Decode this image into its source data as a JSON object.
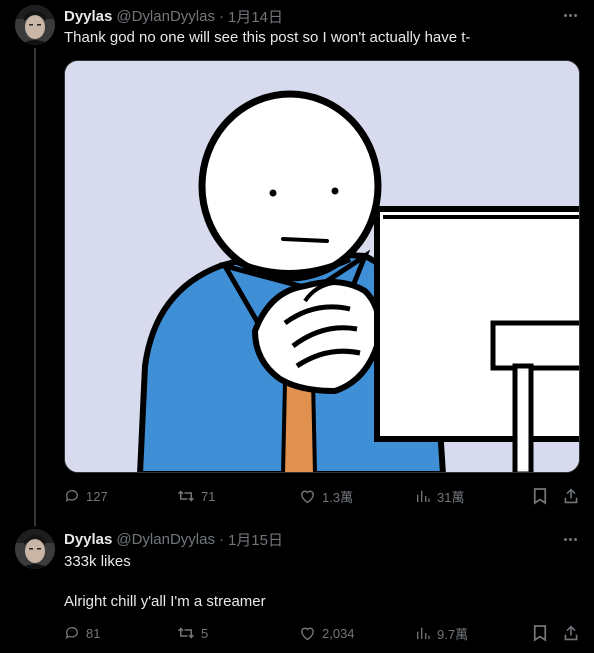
{
  "colors": {
    "background": "#000000",
    "text": "#e7e9ea",
    "muted": "#71767b",
    "line": "#333639"
  },
  "tweets": [
    {
      "author": {
        "name": "Dyylas",
        "handle": "@DylanDyylas"
      },
      "separator": "·",
      "date": "1月14日",
      "text": "Thank god no one will see this post so I won't actually have t-",
      "media": "computer-reaction-meme",
      "stats": {
        "replies": "127",
        "retweets": "71",
        "likes": "1.3萬",
        "views": "31萬"
      }
    },
    {
      "author": {
        "name": "Dyylas",
        "handle": "@DylanDyylas"
      },
      "separator": "·",
      "date": "1月15日",
      "lines": [
        "333k likes",
        "Alright chill y'all I'm a streamer"
      ],
      "stats": {
        "replies": "81",
        "retweets": "5",
        "likes": "2,034",
        "views": "9.7萬"
      }
    }
  ],
  "icons": [
    "more-icon",
    "reply-icon",
    "retweet-icon",
    "like-icon",
    "views-icon",
    "bookmark-icon",
    "share-icon"
  ]
}
